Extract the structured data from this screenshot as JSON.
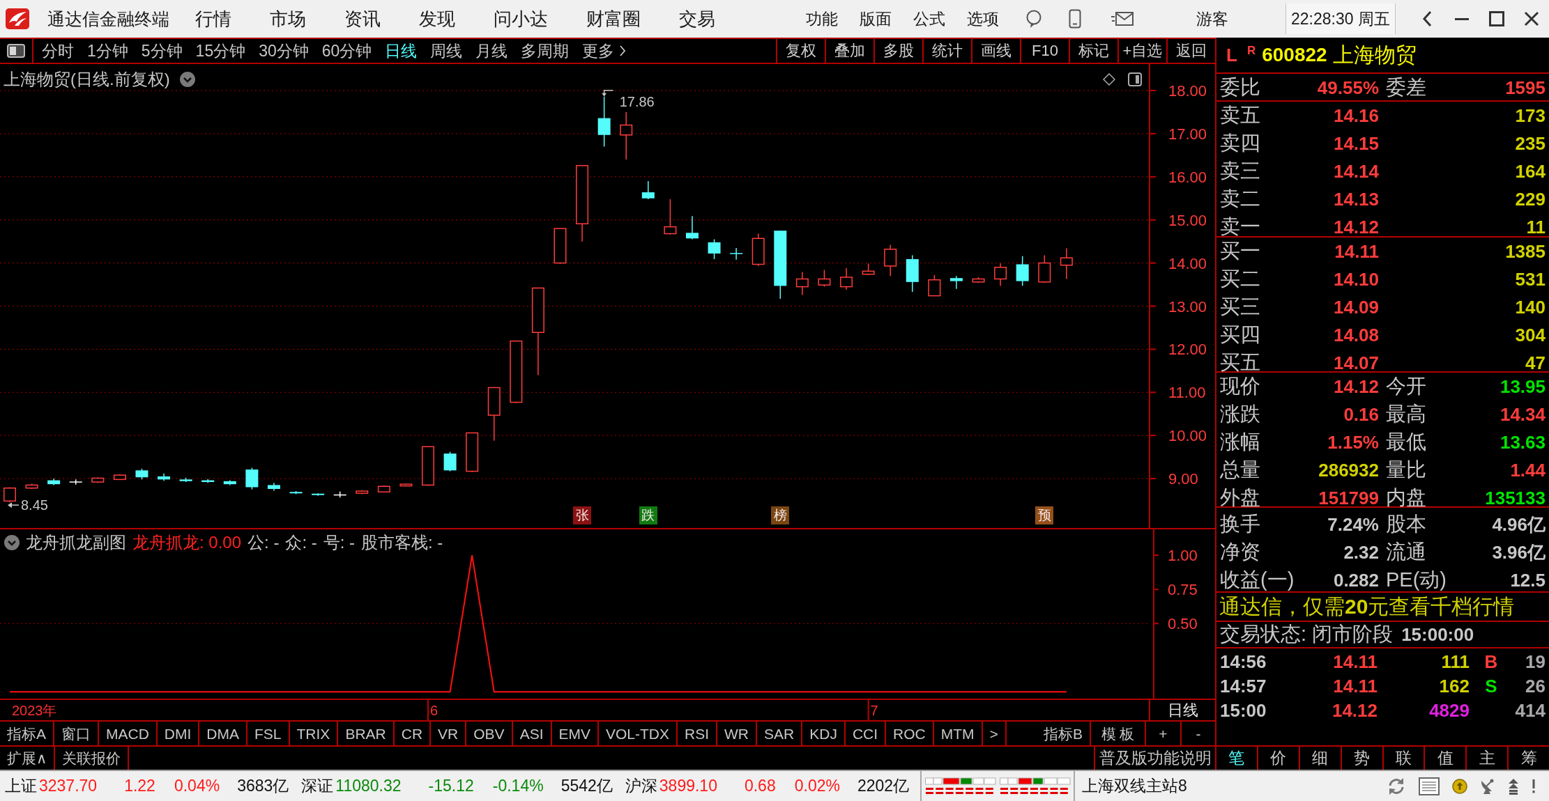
{
  "title_bar": {
    "app_name": "通达信金融终端",
    "menus": [
      "行情",
      "市场",
      "资讯",
      "发现",
      "问小达",
      "财富圈",
      "交易"
    ],
    "tools": [
      "功能",
      "版面",
      "公式",
      "选项"
    ],
    "user": "游客",
    "clock": "22:28:30 周五"
  },
  "period_bar": {
    "periods": [
      {
        "label": "分时",
        "selected": false,
        "kind": "tab"
      },
      {
        "label": "1分钟",
        "selected": false,
        "kind": "tab"
      },
      {
        "label": "5分钟",
        "selected": false,
        "kind": "tab"
      },
      {
        "label": "15分钟",
        "selected": false,
        "kind": "tab"
      },
      {
        "label": "30分钟",
        "selected": false,
        "kind": "tab"
      },
      {
        "label": "60分钟",
        "selected": false,
        "kind": "tab"
      },
      {
        "label": "日线",
        "selected": true,
        "kind": "tab"
      },
      {
        "label": "周线",
        "selected": false,
        "kind": "tab"
      },
      {
        "label": "月线",
        "selected": false,
        "kind": "tab"
      },
      {
        "label": "多周期",
        "selected": false,
        "kind": "tab"
      },
      {
        "label": "更多",
        "selected": false,
        "kind": "dropdown"
      }
    ],
    "actions": [
      "复权",
      "叠加",
      "多股",
      "统计",
      "画线",
      "F10",
      "标记",
      "+自选",
      "返回"
    ]
  },
  "main_chart": {
    "title": "上海物贸(日线.前复权)",
    "price_axis": [
      "18.00",
      "17.00",
      "16.00",
      "15.00",
      "14.00",
      "13.00",
      "12.00",
      "11.00",
      "10.00",
      "9.00"
    ],
    "high_label": "17.86",
    "low_label": "8.45",
    "markers": [
      {
        "label": "张",
        "color": "#8c1212"
      },
      {
        "label": "跌",
        "color": "#117a11"
      },
      {
        "label": "榜",
        "color": "#7a4612"
      },
      {
        "label": "预",
        "color": "#95501a"
      }
    ]
  },
  "sub_chart": {
    "title": "龙舟抓龙副图",
    "legend": [
      {
        "text": "龙舟抓龙: 0.00",
        "color": "#ff2020"
      },
      {
        "text": "公: -",
        "color": "#c8c8c8"
      },
      {
        "text": "众: -",
        "color": "#c8c8c8"
      },
      {
        "text": "号: -",
        "color": "#c8c8c8"
      },
      {
        "text": "股市客栈: -",
        "color": "#c8c8c8"
      }
    ],
    "chart_data": {
      "type": "line",
      "values": [
        0,
        0,
        0,
        0,
        0,
        0,
        0,
        0,
        0,
        0,
        0,
        0,
        0,
        0,
        0,
        0,
        0,
        0,
        0,
        0,
        0,
        1,
        0,
        0,
        0,
        0,
        0,
        0,
        0,
        0,
        0,
        0,
        0,
        0,
        0,
        0,
        0,
        0,
        0,
        0,
        0,
        0,
        0,
        0,
        0,
        0,
        0,
        0,
        0
      ],
      "yticks": [
        {
          "value": 1,
          "label": "1.00"
        },
        {
          "value": 0.75,
          "label": "0.75"
        },
        {
          "value": 0.5,
          "label": "0.50"
        }
      ],
      "ylim": [
        -0.05,
        1.19
      ],
      "ref_lines": [
        {
          "axis": "y",
          "value": 0.5
        }
      ]
    }
  },
  "date_axis": {
    "labels": [
      "2023年",
      "6",
      "7"
    ],
    "period_label": "日线"
  },
  "indicator_bar": {
    "label": "指标A",
    "tabs": [
      "窗口",
      "MACD",
      "DMI",
      "DMA",
      "FSL",
      "TRIX",
      "BRAR",
      "CR",
      "VR",
      "OBV",
      "ASI",
      "EMV",
      "VOL-TDX",
      "RSI",
      "WR",
      "SAR",
      "KDJ",
      "CCI",
      "ROC",
      "MTM"
    ],
    "scroll": ">",
    "label_b": "指标B",
    "buttons": [
      "模 板",
      "+",
      "-"
    ]
  },
  "extension_bar": {
    "buttons": [
      "扩展∧",
      "关联报价"
    ],
    "help_link": "普及版功能说明"
  },
  "quote_panel": {
    "market_flag": "L",
    "margin_flag": "R",
    "code": "600822",
    "name": "上海物贸",
    "order_ratio": [
      {
        "label": "委比",
        "value": "49.55%",
        "color": "#ff3c3c"
      },
      {
        "label": "委差",
        "value": "1595",
        "color": "#ff3c3c"
      }
    ],
    "asks": [
      {
        "label": "卖五",
        "price": "14.16",
        "volume": "173"
      },
      {
        "label": "卖四",
        "price": "14.15",
        "volume": "235"
      },
      {
        "label": "卖三",
        "price": "14.14",
        "volume": "164"
      },
      {
        "label": "卖二",
        "price": "14.13",
        "volume": "229"
      },
      {
        "label": "卖一",
        "price": "14.12",
        "volume": "11"
      }
    ],
    "bids": [
      {
        "label": "买一",
        "price": "14.11",
        "volume": "1385"
      },
      {
        "label": "买二",
        "price": "14.10",
        "volume": "531"
      },
      {
        "label": "买三",
        "price": "14.09",
        "volume": "140"
      },
      {
        "label": "买四",
        "price": "14.08",
        "volume": "304"
      },
      {
        "label": "买五",
        "price": "14.07",
        "volume": "47"
      }
    ],
    "stats": [
      {
        "label": "现价",
        "value": "14.12",
        "color": "#ff3c3c"
      },
      {
        "label": "今开",
        "value": "13.95",
        "color": "#00e400"
      },
      {
        "label": "涨跌",
        "value": "0.16",
        "color": "#ff3c3c"
      },
      {
        "label": "最高",
        "value": "14.34",
        "color": "#ff3c3c"
      },
      {
        "label": "涨幅",
        "value": "1.15%",
        "color": "#ff3c3c"
      },
      {
        "label": "最低",
        "value": "13.63",
        "color": "#00e400"
      },
      {
        "label": "总量",
        "value": "286932",
        "color": "#d2d200"
      },
      {
        "label": "量比",
        "value": "1.44",
        "color": "#ff3c3c"
      },
      {
        "label": "外盘",
        "value": "151799",
        "color": "#ff3c3c"
      },
      {
        "label": "内盘",
        "value": "135133",
        "color": "#00e400"
      }
    ],
    "fundamentals": [
      {
        "label": "换手",
        "value": "7.24%"
      },
      {
        "label": "股本",
        "value": "4.96亿"
      },
      {
        "label": "净资",
        "value": "2.32"
      },
      {
        "label": "流通",
        "value": "3.96亿"
      },
      {
        "label": "收益(一)",
        "value": "0.282"
      },
      {
        "label": "PE(动)",
        "value": "12.5"
      }
    ],
    "promo": "通达信，仅需**20**元查看千档行情",
    "trading_status": "交易状态: 闭市阶段",
    "status_time": "15:00:00",
    "ticks": [
      {
        "time": "14:56",
        "price": "14.11",
        "volume": "111",
        "side": "B",
        "count": "19",
        "kind": "buy"
      },
      {
        "time": "14:57",
        "price": "14.11",
        "volume": "162",
        "side": "S",
        "count": "26",
        "kind": "sell"
      },
      {
        "time": "15:00",
        "price": "14.12",
        "volume": "4829",
        "count": "414",
        "kind": "auction"
      }
    ],
    "tabs": [
      {
        "label": "笔",
        "selected": true
      },
      {
        "label": "价",
        "selected": false
      },
      {
        "label": "细",
        "selected": false
      },
      {
        "label": "势",
        "selected": false
      },
      {
        "label": "联",
        "selected": false
      },
      {
        "label": "值",
        "selected": false
      },
      {
        "label": "主",
        "selected": false
      },
      {
        "label": "筹",
        "selected": false
      }
    ]
  },
  "status_bar": {
    "indices": [
      {
        "name": "上证",
        "value": "3237.70",
        "change": "1.22",
        "percent": "0.04%",
        "amount": "3683亿",
        "color": "#ff1a1a"
      },
      {
        "name": "深证",
        "value": "11080.32",
        "change": "-15.12",
        "percent": "-0.14%",
        "amount": "5542亿",
        "color": "#0a8a0a"
      },
      {
        "name": "沪深",
        "value": "3899.10",
        "change": "0.68",
        "percent": "0.02%",
        "amount": "2202亿",
        "color": "#ff1a1a"
      }
    ],
    "server": "上海双线主站8"
  }
}
